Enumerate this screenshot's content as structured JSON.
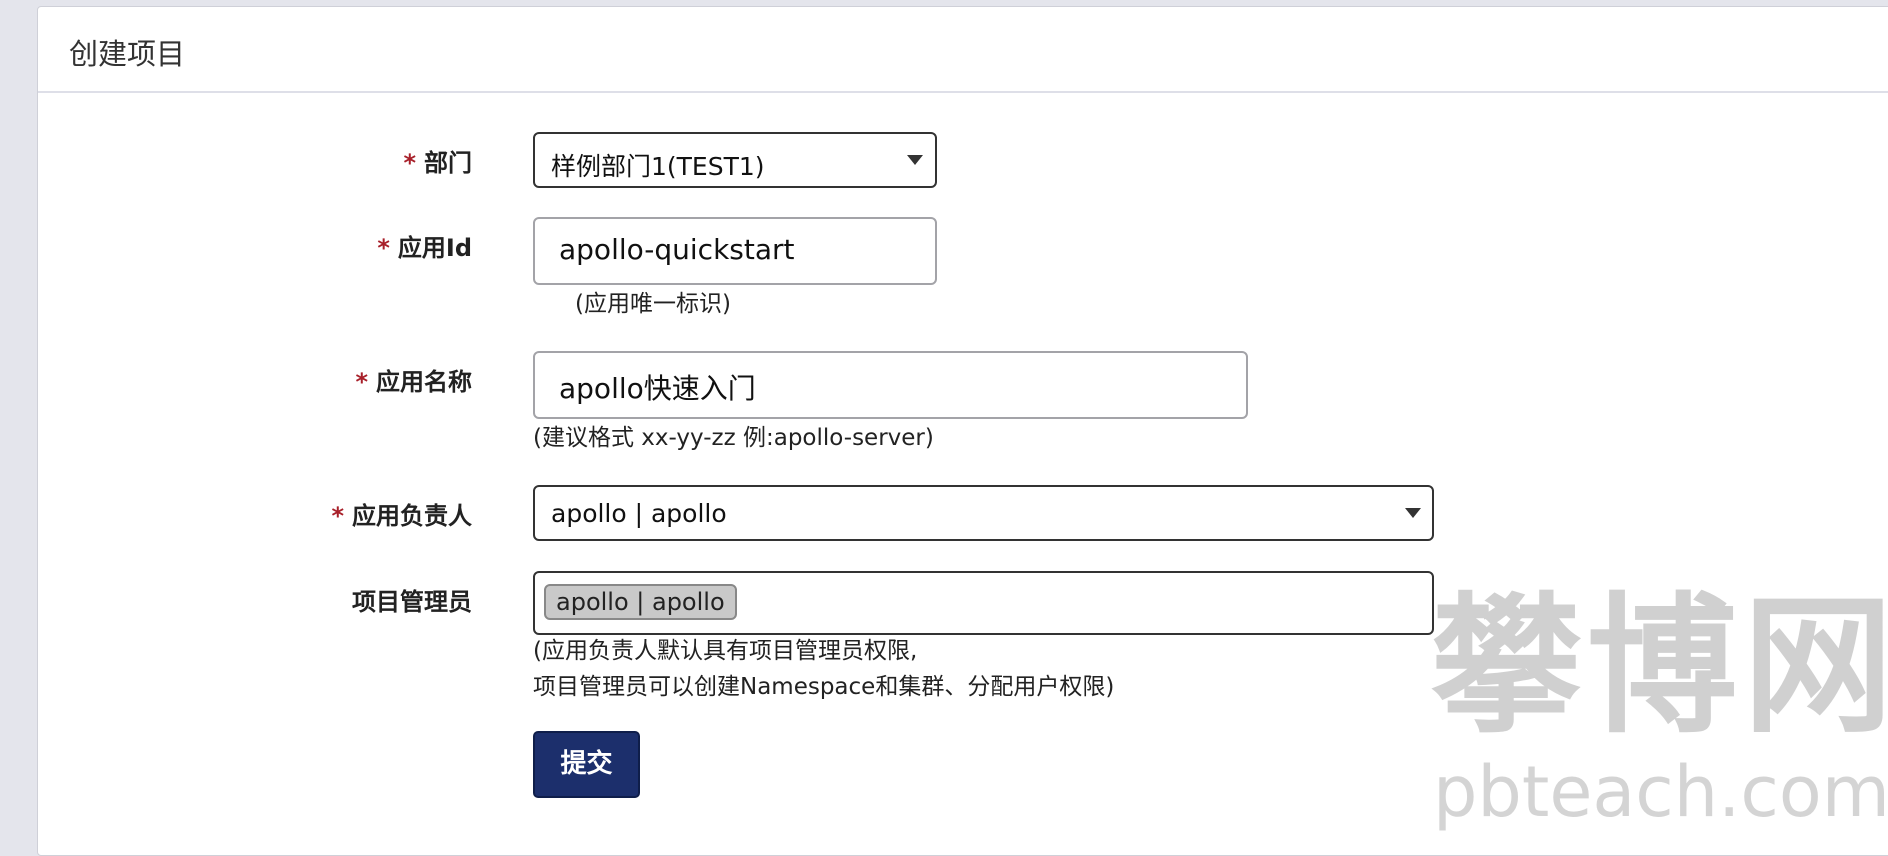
{
  "panel": {
    "title": "创建项目"
  },
  "form": {
    "department": {
      "label": "部门",
      "value": "样例部门1(TEST1)"
    },
    "app_id": {
      "label": "应用Id",
      "value": "apollo-quickstart",
      "help": "(应用唯一标识)"
    },
    "app_name": {
      "label": "应用名称",
      "value": "apollo快速入门",
      "help": "(建议格式 xx-yy-zz 例:apollo-server)"
    },
    "app_owner": {
      "label": "应用负责人",
      "value": "apollo | apollo"
    },
    "project_admins": {
      "label": "项目管理员",
      "tags": [
        "apollo | apollo"
      ],
      "help_line1": "(应用负责人默认具有项目管理员权限,",
      "help_line2": "项目管理员可以创建Namespace和集群、分配用户权限)"
    },
    "required_mark": "*",
    "submit_label": "提交"
  },
  "watermark": {
    "cn": "攀博网",
    "en": "pbteach.com"
  }
}
